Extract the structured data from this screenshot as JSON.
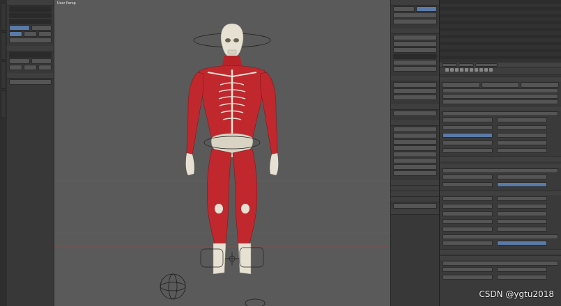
{
  "viewport": {
    "title": "User Persp"
  },
  "watermark": {
    "text": "CSDN @ygtu2018"
  },
  "colors": {
    "muscle": "#c0282e",
    "bone": "#e6e1d2",
    "viewport_bg": "#5a5a5a",
    "panel_bg": "#383838",
    "accent": "#5a7aa8"
  },
  "icons": [
    "transform-gizmo-icon",
    "camera-icon",
    "render-icon"
  ]
}
